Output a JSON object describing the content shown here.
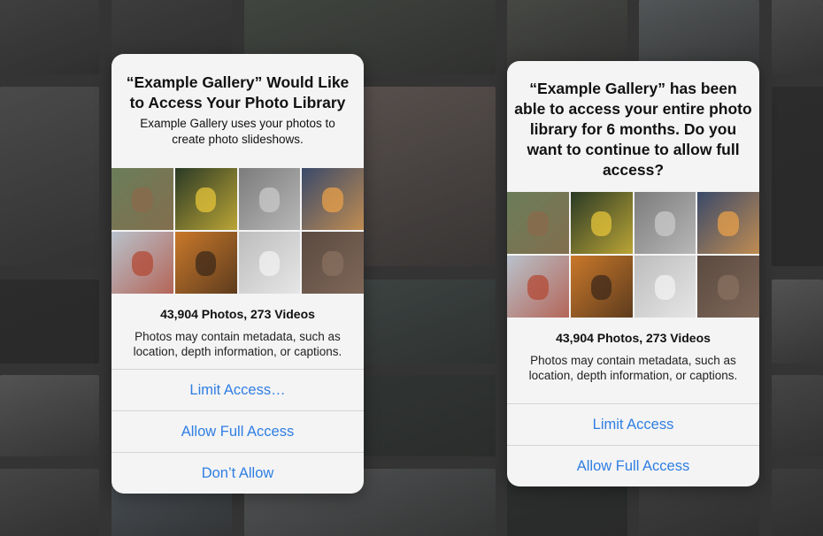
{
  "background": {
    "tile_colors": [
      "#4e4e4e",
      "#5f5f5f",
      "#2f2f2f",
      "#6e6e6e",
      "#585858",
      "#4a4a4a",
      "#545b5e",
      "#6a6a6a",
      "#2d3033",
      "#606a73",
      "#51584f",
      "#7d6f6a",
      "#4e5d59",
      "#37413d",
      "#6b6e70",
      "#5a5d57",
      "#3a3a3a",
      "#4a4f52",
      "#575757",
      "#2f3433",
      "#6d7275",
      "#4a5258",
      "#595959",
      "#383c3e"
    ]
  },
  "dialog_initial": {
    "title": "“Example Gallery” Would Like to Access Your Photo Library",
    "subtitle": "Example Gallery uses your photos to create photo slideshows.",
    "count": "43,904 Photos, 273 Videos",
    "note": "Photos may contain metadata, such as location, depth information, or captions.",
    "buttons": [
      "Limit Access…",
      "Allow Full Access",
      "Don’t Allow"
    ]
  },
  "dialog_reminder": {
    "title": "“Example Gallery” has been able to access your entire photo library for 6 months. Do you want to continue to allow full access?",
    "count": "43,904 Photos, 273 Videos",
    "note": "Photos may contain metadata, such as location, depth information, or captions.",
    "buttons": [
      "Limit Access",
      "Allow Full Access"
    ]
  },
  "thumbnails": [
    {
      "name": "hiker-thumbnail",
      "color": "#6a7d5a",
      "accent": "#8a6a4a"
    },
    {
      "name": "daffodils-thumbnail",
      "color": "#2b3a26",
      "accent": "#e5c43a"
    },
    {
      "name": "cat-thumbnail",
      "color": "#7c7c7c",
      "accent": "#c9c9c9"
    },
    {
      "name": "silhouette-sunset-thumbnail",
      "color": "#3a4a6a",
      "accent": "#e8a04a"
    },
    {
      "name": "golden-gate-bridge-thumbnail",
      "color": "#b8c2cc",
      "accent": "#b34a35"
    },
    {
      "name": "ocean-sunset-thumbnail",
      "color": "#c9782a",
      "accent": "#3d2a1a"
    },
    {
      "name": "vintage-car-thumbnail",
      "color": "#bdbdbd",
      "accent": "#f2f2f2"
    },
    {
      "name": "rock-closeup-thumbnail",
      "color": "#5a4a40",
      "accent": "#8a7060"
    }
  ]
}
